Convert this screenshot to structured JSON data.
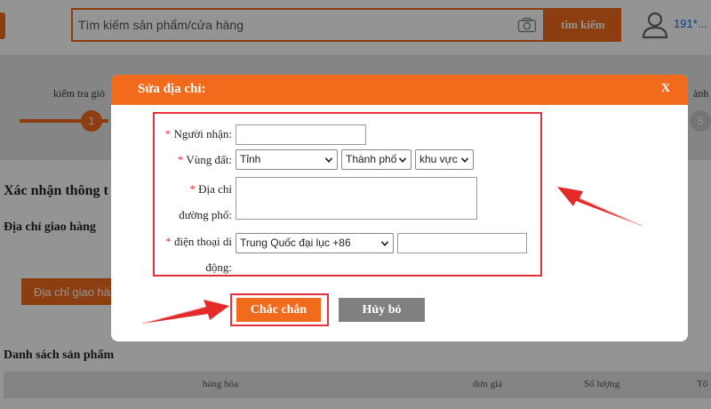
{
  "header": {
    "search_placeholder": "Tìm kiếm sản phẩm/cửa hàng",
    "search_button": "tìm kiếm",
    "user_name": "191*..."
  },
  "steps": {
    "step1_label": "kiểm tra giỏ",
    "step1_number": "1",
    "step5_label": "ành gi",
    "step5_number": "5"
  },
  "page": {
    "confirm_title": "Xác nhận thông t",
    "address_section": "Địa chỉ giao hàng",
    "address_button": "Địa chỉ giao hàng",
    "product_list_title": "Danh sách sản phẩm",
    "table_headers": [
      "hàng hóa",
      "đơn giá",
      "Số lượng",
      "Tổ"
    ]
  },
  "modal": {
    "title": "Sửa địa chỉ:",
    "close": "X",
    "required_mark": "*",
    "recipient_label": "Người nhận:",
    "region_label": "Vùng đất:",
    "street_label_line1": "Địa chỉ",
    "street_label_line2": "đường phố:",
    "phone_label_line1": "điện thoại di",
    "phone_label_line2": "động:",
    "province_select": "Tỉnh",
    "city_select": "Thành phố",
    "area_select": "khu vực",
    "country_select": "Trung Quốc đại lục +86",
    "recipient_value": "",
    "phone_value": "",
    "confirm_button": "Chắc chắn",
    "cancel_button": "Hủy bỏ"
  },
  "colors": {
    "brand": "#f26b1d",
    "highlight": "#e8303a",
    "cancel": "#808080"
  }
}
